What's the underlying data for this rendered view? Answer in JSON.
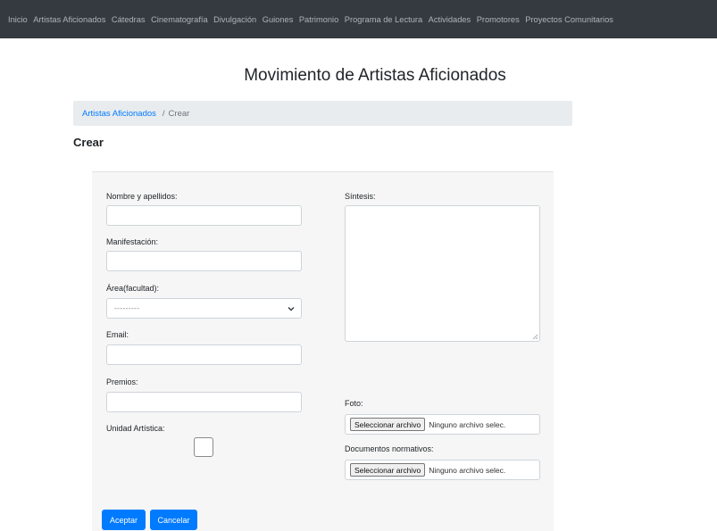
{
  "nav": {
    "items": [
      "Inicio",
      "Artistas Aficionados",
      "Cátedras",
      "Cinematografía",
      "Divulgación",
      "Guiones",
      "Patrimonio",
      "Programa de Lectura",
      "Actividades",
      "Promotores",
      "Proyectos Comunitarios"
    ]
  },
  "page": {
    "title": "Movimiento de Artistas Aficionados",
    "section_title": "Crear"
  },
  "breadcrumb": {
    "link": "Artistas Aficionados",
    "separator": "/",
    "current": "Crear"
  },
  "form": {
    "nombre_label": "Nombre y apellidos:",
    "nombre_value": "",
    "manifestacion_label": "Manifestación:",
    "manifestacion_value": "",
    "area_label": "Área(facultad):",
    "area_selected": "---------",
    "email_label": "Email:",
    "email_value": "",
    "premios_label": "Premios:",
    "premios_value": "",
    "unidad_label": "Unidad Artística:",
    "sintesis_label": "Síntesis:",
    "foto_label": "Foto:",
    "documentos_label": "Documentos normativos:",
    "file_button": "Seleccionar archivo",
    "file_status": "Ninguno archivo selec.",
    "accept_button": "Aceptar",
    "cancel_button": "Cancelar"
  },
  "colors": {
    "navbar": "#343a40",
    "primary": "#007bff",
    "breadcrumb_bg": "#e9ecef",
    "card_bg": "#f6f6f6"
  }
}
